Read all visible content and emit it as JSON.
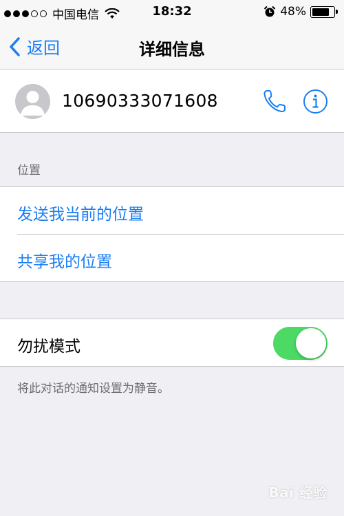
{
  "status_bar": {
    "carrier": "中国电信",
    "signal_icon": "signal-dots-icon",
    "wifi_icon": "wifi-icon",
    "time": "18:32",
    "alarm_icon": "alarm-clock-icon",
    "battery_percent": "48%",
    "battery_level": 0.8
  },
  "nav": {
    "back_label": "返回",
    "title": "详细信息",
    "accent_color": "#1a7df4"
  },
  "contact": {
    "number": "10690333071608",
    "call_icon": "phone-icon",
    "info_icon": "info-icon"
  },
  "location_section": {
    "header": "位置",
    "items": [
      {
        "label": "发送我当前的位置"
      },
      {
        "label": "共享我的位置"
      }
    ]
  },
  "dnd": {
    "label": "勿扰模式",
    "enabled": true,
    "toggle_color": "#4cd964",
    "footer": "将此对话的通知设置为静音。"
  },
  "watermark": {
    "text": "Bai 经验"
  }
}
